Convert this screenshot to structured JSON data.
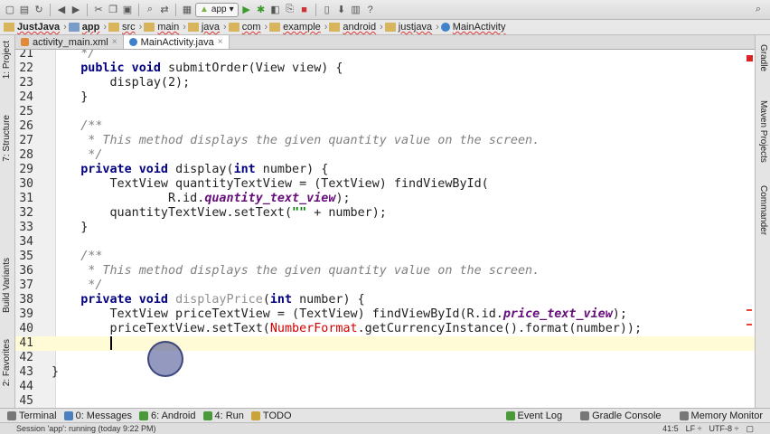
{
  "toolbar": {
    "run_config_label": "app",
    "icons": [
      "new-file-icon",
      "save-icon",
      "sync-icon",
      "back-icon",
      "forward-icon",
      "cut-icon",
      "copy-icon",
      "paste-icon",
      "find-icon",
      "replace-icon",
      "make-icon",
      "run-icon",
      "debug-icon",
      "coverage-icon",
      "attach-icon",
      "stop-icon",
      "avd-icon",
      "sdk-icon",
      "project-structure-icon",
      "help-icon",
      "search-icon"
    ]
  },
  "breadcrumbs": [
    "JustJava",
    "app",
    "src",
    "main",
    "java",
    "com",
    "example",
    "android",
    "justjava",
    "MainActivity"
  ],
  "tabs": [
    {
      "label": "activity_main.xml",
      "active": false
    },
    {
      "label": "MainActivity.java",
      "active": true
    }
  ],
  "left_tools": [
    "1: Project",
    "7: Structure",
    "Build Variants",
    "2: Favorites"
  ],
  "right_tools": [
    "Gradle",
    "Maven Projects",
    "Commander"
  ],
  "editor": {
    "current_line": "41",
    "lines": [
      {
        "n": "21",
        "t": [
          [
            "cm",
            "    */"
          ]
        ]
      },
      {
        "n": "22",
        "t": [
          [
            "kw",
            "    public void "
          ],
          [
            "",
            "submitOrder(View view) {"
          ]
        ]
      },
      {
        "n": "23",
        "t": [
          [
            "",
            "        display(2);"
          ]
        ]
      },
      {
        "n": "24",
        "t": [
          [
            "",
            "    }"
          ]
        ]
      },
      {
        "n": "25",
        "t": []
      },
      {
        "n": "26",
        "t": [
          [
            "cm",
            "    /**"
          ]
        ]
      },
      {
        "n": "27",
        "t": [
          [
            "cm",
            "     * This method displays the given quantity value on the screen."
          ]
        ]
      },
      {
        "n": "28",
        "t": [
          [
            "cm",
            "     */"
          ]
        ]
      },
      {
        "n": "29",
        "t": [
          [
            "kw",
            "    private void "
          ],
          [
            "",
            "display("
          ],
          [
            "kw",
            "int"
          ],
          [
            "",
            " number) {"
          ]
        ]
      },
      {
        "n": "30",
        "t": [
          [
            "",
            "        TextView quantityTextView = (TextView) findViewById("
          ]
        ]
      },
      {
        "n": "31",
        "t": [
          [
            "",
            "                R.id."
          ],
          [
            "fld",
            "quantity_text_view"
          ],
          [
            "",
            ");"
          ]
        ]
      },
      {
        "n": "32",
        "t": [
          [
            "",
            "        quantityTextView.setText("
          ],
          [
            "str",
            "\"\""
          ],
          [
            "",
            " + number);"
          ]
        ]
      },
      {
        "n": "33",
        "t": [
          [
            "",
            "    }"
          ]
        ]
      },
      {
        "n": "34",
        "t": []
      },
      {
        "n": "35",
        "t": [
          [
            "cm",
            "    /**"
          ]
        ]
      },
      {
        "n": "36",
        "t": [
          [
            "cm",
            "     * This method displays the given quantity value on the screen."
          ]
        ]
      },
      {
        "n": "37",
        "t": [
          [
            "cm",
            "     */"
          ]
        ]
      },
      {
        "n": "38",
        "t": [
          [
            "kw",
            "    private void "
          ],
          [
            "unused",
            "displayPrice"
          ],
          [
            "",
            "("
          ],
          [
            "kw",
            "int"
          ],
          [
            "",
            " number) {"
          ]
        ]
      },
      {
        "n": "39",
        "t": [
          [
            "",
            "        TextView priceTextView = (TextView) findViewById(R.id."
          ],
          [
            "fld",
            "price_text_view"
          ],
          [
            "",
            ");"
          ]
        ]
      },
      {
        "n": "40",
        "t": [
          [
            "",
            "        priceTextView.setText("
          ],
          [
            "err",
            "NumberFormat"
          ],
          [
            "",
            ".getCurrencyInstance().format(number));"
          ]
        ]
      },
      {
        "n": "41",
        "t": [
          [
            "",
            "        "
          ]
        ]
      },
      {
        "n": "42",
        "t": []
      },
      {
        "n": "43",
        "t": [
          [
            "",
            "}"
          ]
        ]
      },
      {
        "n": "44",
        "t": []
      },
      {
        "n": "45",
        "t": []
      }
    ]
  },
  "bottom_tabs_left": [
    {
      "label": "Terminal",
      "icon": "terminal-icon"
    },
    {
      "label": "0: Messages",
      "icon": "messages-icon"
    },
    {
      "label": "6: Android",
      "icon": "android-icon"
    },
    {
      "label": "4: Run",
      "icon": "run-icon"
    },
    {
      "label": "TODO",
      "icon": "todo-icon"
    }
  ],
  "bottom_tabs_right": [
    {
      "label": "Event Log",
      "icon": "event-log-icon"
    },
    {
      "label": "Gradle Console",
      "icon": "gradle-console-icon"
    },
    {
      "label": "Memory Monitor",
      "icon": "memory-monitor-icon"
    }
  ],
  "status": {
    "message": "Session 'app': running (today 9:22 PM)",
    "position": "41:5",
    "separator": "LF ÷",
    "encoding": "UTF-8 ÷"
  }
}
